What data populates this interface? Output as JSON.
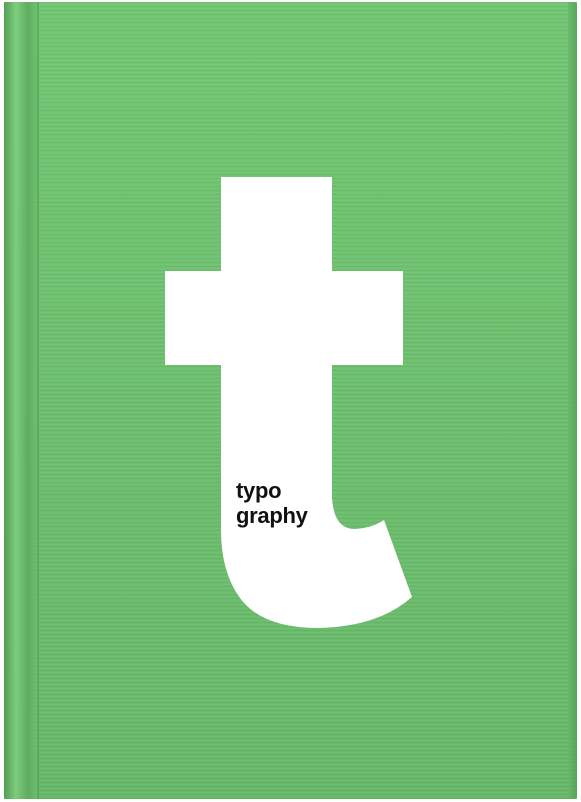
{
  "cover": {
    "background_color": "#6ec16f",
    "letter_color": "#ffffff",
    "text_color": "#111111",
    "letter_motif": "lowercase-t",
    "title_line_1": "typo",
    "title_line_2": "graphy"
  }
}
